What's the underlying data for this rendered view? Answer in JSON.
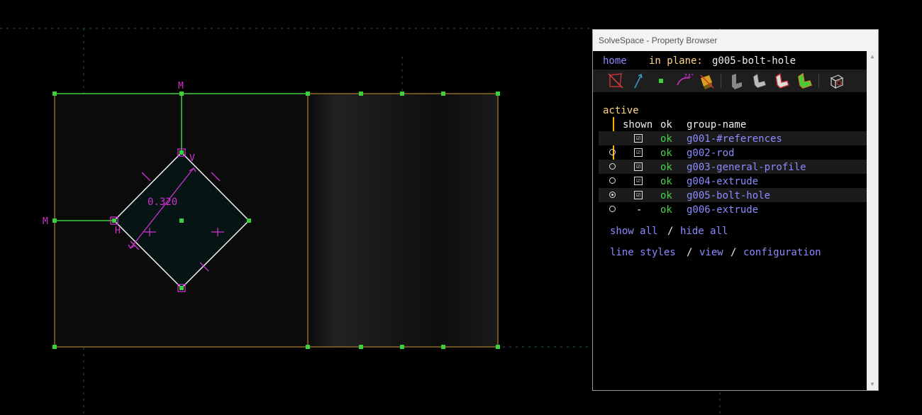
{
  "window": {
    "title": "SolveSpace - Property Browser"
  },
  "nav": {
    "home": "home",
    "in_plane_label": "in plane:",
    "in_plane_value": "g005-bolt-hole"
  },
  "toolbar": {
    "icons": [
      "sketch-in-plane-icon",
      "line-icon",
      "point-icon",
      "angle-icon",
      "extrude-icon",
      "step-linear-icon",
      "step-rotate-icon",
      "revolve-icon",
      "lathe-icon",
      "workplane-icon"
    ]
  },
  "sketch": {
    "dimension_label": "0.320",
    "markers": {
      "m_top": "M",
      "m_left": "M",
      "v": "V",
      "h": "H"
    }
  },
  "groups": {
    "active_header": "active",
    "shown_header": "shown",
    "ok_header": "ok",
    "name_header": "group-name",
    "rows": [
      {
        "radio": "",
        "shown": "☑",
        "ok": "ok",
        "name": "g001-#references"
      },
      {
        "radio": "○",
        "shown": "☑",
        "ok": "ok",
        "name": "g002-rod"
      },
      {
        "radio": "○",
        "shown": "☑",
        "ok": "ok",
        "name": "g003-general-profile"
      },
      {
        "radio": "○",
        "shown": "☑",
        "ok": "ok",
        "name": "g004-extrude"
      },
      {
        "radio": "◉",
        "shown": "☑",
        "ok": "ok",
        "name": "g005-bolt-hole"
      },
      {
        "radio": "○",
        "shown": "-",
        "ok": "ok",
        "name": "g006-extrude"
      }
    ]
  },
  "links": {
    "show_all": "show all",
    "sep1": "/",
    "hide_all": "hide all",
    "line_styles": "line styles",
    "sep2": "/",
    "view": "view",
    "sep3": "/",
    "configuration": "configuration"
  }
}
